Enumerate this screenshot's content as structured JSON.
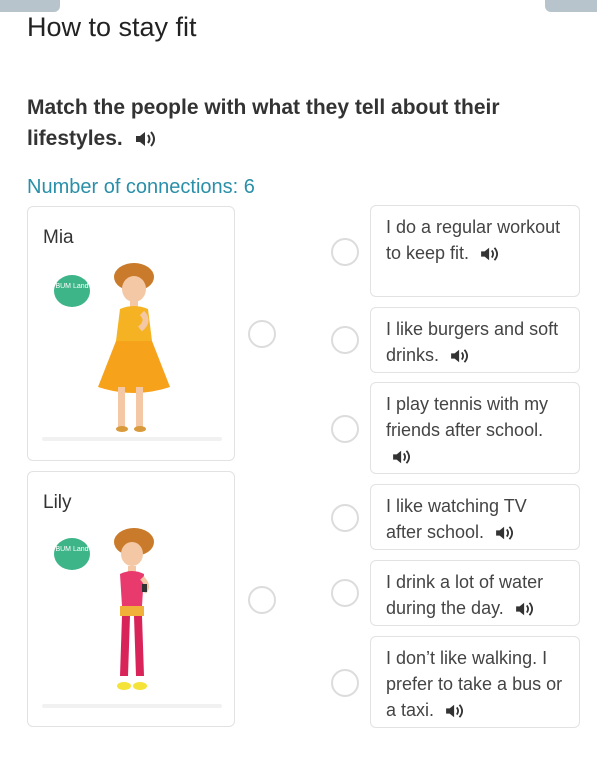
{
  "page": {
    "title": "How to stay fit"
  },
  "task": {
    "instruction": "Match the people with what they tell about their lifestyles.",
    "connections_label": "Number of connections: 6"
  },
  "people": [
    {
      "name": "Mia",
      "badge": "BUM Land"
    },
    {
      "name": "Lily",
      "badge": "BUM Land"
    }
  ],
  "statements": [
    {
      "text": "I do a regular workout to keep fit."
    },
    {
      "text": "I like burgers and soft drinks."
    },
    {
      "text": "I play tennis with my friends after school."
    },
    {
      "text": "I like watching TV after school."
    },
    {
      "text": "I drink a lot of water during the day."
    },
    {
      "text": "I don’t like walking. I prefer to take a bus or a taxi."
    }
  ],
  "icons": {
    "speaker": "speaker-icon"
  },
  "colors": {
    "accent": "#2a8fa8",
    "badge": "#3eb489",
    "border": "#e2e2e2"
  }
}
